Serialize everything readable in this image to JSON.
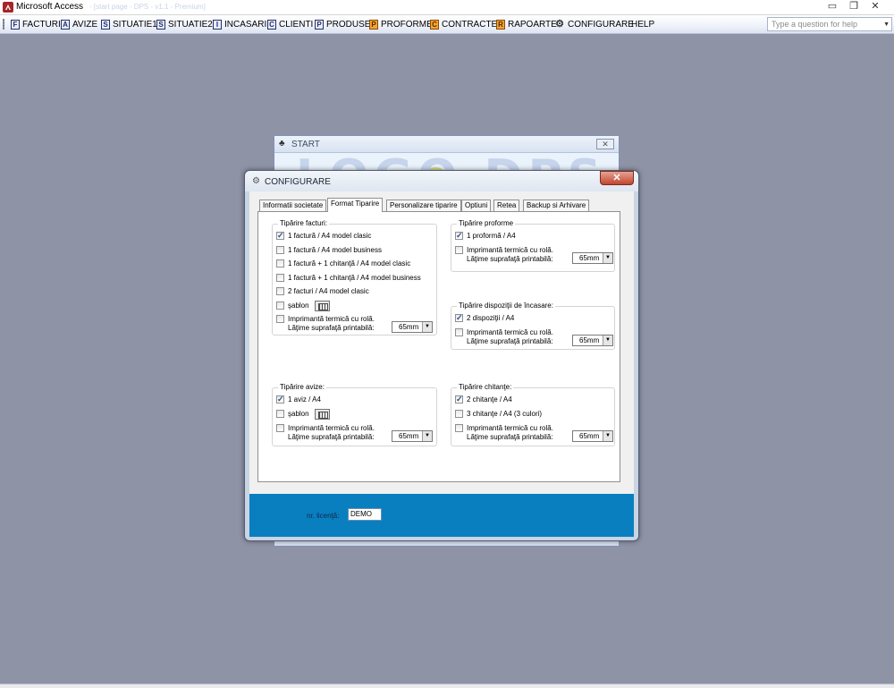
{
  "app": {
    "title": "Microsoft Access",
    "subtitle": "- [start page - DPS - v1.1 - Premium]",
    "help_placeholder": "Type a question for help"
  },
  "menu": [
    {
      "label": "FACTURI",
      "icon": "F"
    },
    {
      "label": "AVIZE",
      "icon": "A"
    },
    {
      "label": "SITUATIE1",
      "icon": "S"
    },
    {
      "label": "SITUATIE2",
      "icon": "S"
    },
    {
      "label": "INCASARI",
      "icon": "I"
    },
    {
      "label": "CLIENTI",
      "icon": "C"
    },
    {
      "label": "PRODUSE",
      "icon": "P"
    },
    {
      "label": "PROFORME",
      "icon": "P"
    },
    {
      "label": "CONTRACTE",
      "icon": "C"
    },
    {
      "label": "RAPOARTE",
      "icon": "R"
    },
    {
      "label": "CONFIGURARE",
      "icon": "gear-icon"
    },
    {
      "label": "HELP",
      "icon": ""
    }
  ],
  "start_window": {
    "title": "START",
    "logo": "LOGO DPS"
  },
  "config_window": {
    "title": "CONFIGURARE",
    "tabs": [
      "Informatii societate",
      "Format Tiparire",
      "Personalizare tiparire",
      "Optiuni",
      "Retea",
      "Backup si Arhivare"
    ],
    "active_tab": "Format Tiparire",
    "groups": {
      "facturi": {
        "title": "Tipărire facturi:",
        "options": [
          {
            "label": "1 factură / A4 model clasic",
            "checked": true
          },
          {
            "label": "1 factură / A4 model business",
            "checked": false
          },
          {
            "label": "1 factură + 1 chitanţă / A4 model clasic",
            "checked": false
          },
          {
            "label": "1 factură + 1 chitanţă / A4 model business",
            "checked": false
          },
          {
            "label": "2 facturi / A4 model clasic",
            "checked": false
          },
          {
            "label": "şablon",
            "checked": false
          },
          {
            "label": "Imprimantă termică cu rolă.",
            "checked": false
          }
        ],
        "width_label": "Lăţime suprafaţă printabilă:",
        "width_value": "65mm"
      },
      "proforme": {
        "title": "Tipărire proforme",
        "options": [
          {
            "label": "1 proformă / A4",
            "checked": true
          },
          {
            "label": "Imprimantă termică cu rolă.",
            "checked": false
          }
        ],
        "width_label": "Lăţime suprafaţă printabilă:",
        "width_value": "65mm"
      },
      "dispozitii": {
        "title": "Tipărire dispoziţii de încasare:",
        "options": [
          {
            "label": "2 dispoziţii / A4",
            "checked": true
          },
          {
            "label": "Imprimantă termică cu rolă.",
            "checked": false
          }
        ],
        "width_label": "Lăţime suprafaţă printabilă:",
        "width_value": "65mm"
      },
      "avize": {
        "title": "Tipărire avize:",
        "options": [
          {
            "label": "1 aviz / A4",
            "checked": true
          },
          {
            "label": "şablon",
            "checked": false
          },
          {
            "label": "Imprimantă termică cu rolă.",
            "checked": false
          }
        ],
        "width_label": "Lăţime suprafaţă printabilă:",
        "width_value": "65mm"
      },
      "chitante": {
        "title": "Tipărire chitanţe:",
        "options": [
          {
            "label": "2 chitanţe / A4",
            "checked": true
          },
          {
            "label": "3 chitanţe / A4 (3 culori)",
            "checked": false
          },
          {
            "label": "Imprimantă termică cu rolă.",
            "checked": false
          }
        ],
        "width_label": "Lăţime suprafaţă printabilă:",
        "width_value": "65mm"
      }
    },
    "license_label": "nr. licenţă:",
    "license_value": "DEMO"
  },
  "colors": {
    "desktop": "#8e93a6",
    "footer_blue": "#0a7fc0",
    "close_red": "#c0452f"
  }
}
